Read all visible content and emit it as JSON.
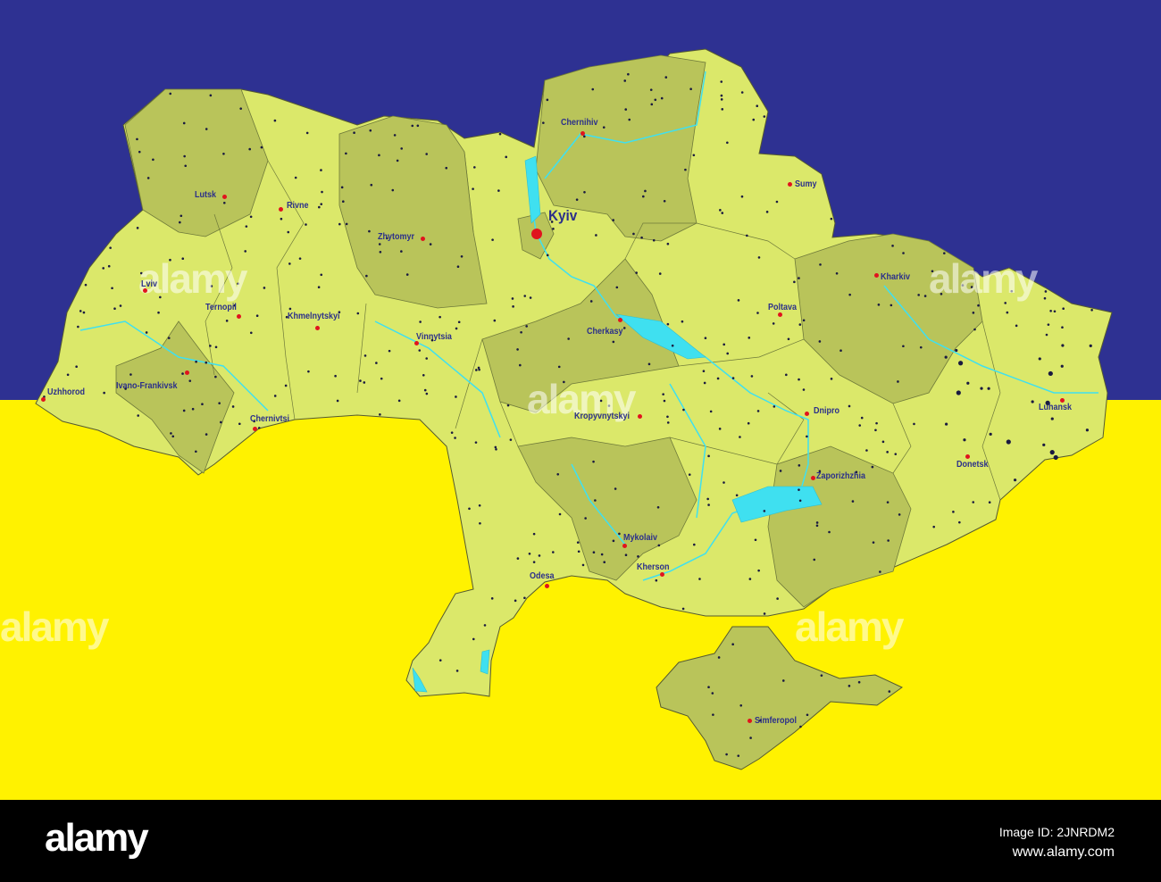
{
  "map": {
    "colors": {
      "flag_blue": "#2e3192",
      "flag_yellow": "#fff200",
      "region_light": "#dbe86a",
      "region_dark": "#b9c45a",
      "water": "#3fe0f0",
      "label": "#2b2f8a",
      "city_dot": "#e0141e"
    },
    "capital": "Kyiv",
    "cities": [
      "Lutsk",
      "Rivne",
      "Zhytomyr",
      "Chernihiv",
      "Sumy",
      "Lviv",
      "Ternopil",
      "Khmelnytskyi",
      "Vinnytsia",
      "Cherkasy",
      "Poltava",
      "Kharkiv",
      "Luhansk",
      "Uzhhorod",
      "Ivano-Frankivsk",
      "Chernivtsi",
      "Kropyvnytskyi",
      "Dnipro",
      "Donetsk",
      "Zaporizhzhia",
      "Mykolaiv",
      "Kherson",
      "Odesa",
      "Simferopol"
    ]
  },
  "watermark": "alamy",
  "footer": {
    "logo": "alamy",
    "image_id": "Image ID: 2JNRDM2",
    "url": "www.alamy.com"
  }
}
